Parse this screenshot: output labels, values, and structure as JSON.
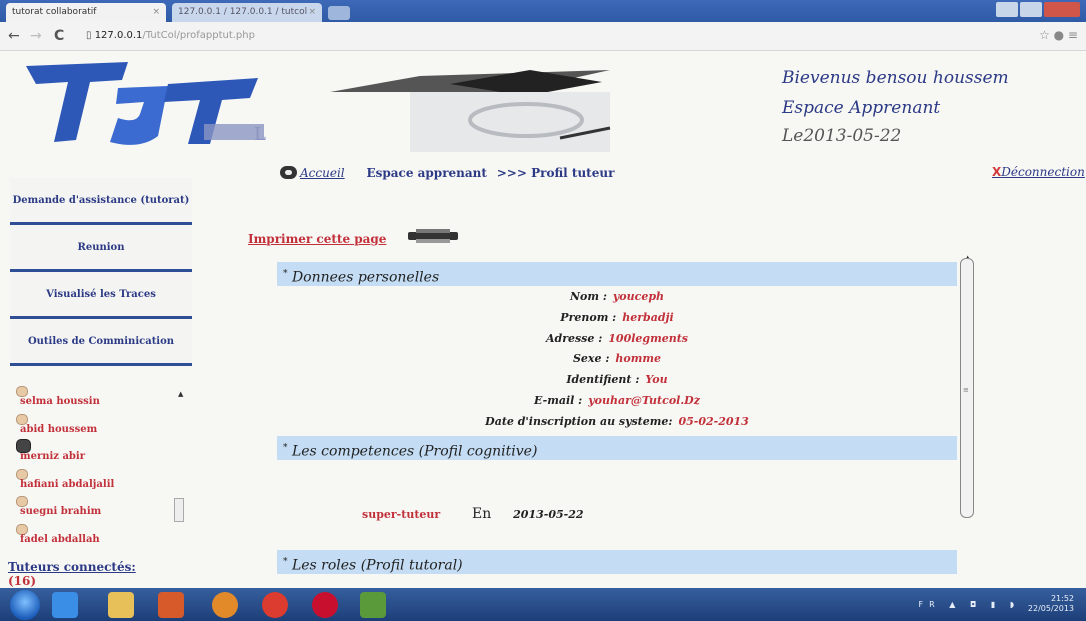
{
  "browser": {
    "tab_active": "tutorat collaboratif",
    "tab_inactive": "127.0.0.1 / 127.0.0.1 / tutcol",
    "url_host": "127.0.0.1",
    "url_path": "/TutCol/profapptut.php"
  },
  "header": {
    "welcome": "Bievenus bensou houssem",
    "space": "Espace Apprenant",
    "date": "Le2013-05-22"
  },
  "breadcrumb": {
    "home": "Accueil",
    "espace": "Espace apprenant",
    "current": ">>> Profil tuteur"
  },
  "logout": {
    "icon": "X",
    "label": "Déconnection"
  },
  "menu": [
    {
      "label": "Demande d'assistance (tutorat)"
    },
    {
      "label": "Reunion"
    },
    {
      "label": "Visualisé les Traces"
    },
    {
      "label": "Outiles de Comminication"
    }
  ],
  "users": [
    {
      "name": "selma houssin",
      "avatar": "face-icon"
    },
    {
      "name": "abid houssem",
      "avatar": "face-icon"
    },
    {
      "name": "merniz abir",
      "avatar": "face-dark-icon"
    },
    {
      "name": "hafiani abdaljalil",
      "avatar": "face-icon"
    },
    {
      "name": "suegni brahim",
      "avatar": "face-icon"
    },
    {
      "name": "fadel abdallah",
      "avatar": "face-icon"
    }
  ],
  "tuteurs": {
    "label": "Tuteurs connectés:",
    "count": "(16)"
  },
  "print_label": "Imprimer cette page",
  "sections": {
    "personal": "Donnees personelles",
    "competences": "Les competences (Profil cognitive)",
    "roles": "Les roles (Profil tutoral)",
    "bullet": "*"
  },
  "fields": [
    {
      "label": "Nom :",
      "value": "youceph"
    },
    {
      "label": "Prenom :",
      "value": "herbadji"
    },
    {
      "label": "Adresse :",
      "value": "100legments"
    },
    {
      "label": "Sexe :",
      "value": "homme"
    },
    {
      "label": "Identifient :",
      "value": "You"
    },
    {
      "label": "E-mail :",
      "value": "youhar@Tutcol.Dz"
    },
    {
      "label": "Date d'inscription au systeme:",
      "value": "05-02-2013"
    }
  ],
  "competence": {
    "level": "super-tuteur",
    "en": "En",
    "date": "2013-05-22"
  },
  "taskbar": {
    "lang": "FR",
    "time": "21:52",
    "date": "22/05/2013"
  },
  "colors": {
    "accent_blue": "#2c3a86",
    "accent_red": "#c2303a",
    "section_bg": "#c4ddf4"
  }
}
